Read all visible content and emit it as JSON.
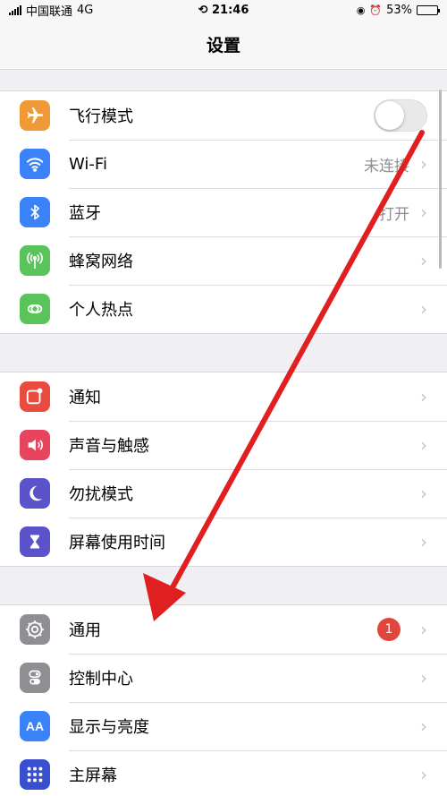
{
  "status_bar": {
    "carrier": "中国联通",
    "network": "4G",
    "time": "21:46",
    "battery": "53%",
    "battery_level": 0.53
  },
  "nav": {
    "title": "设置"
  },
  "groups": [
    {
      "items": [
        {
          "label": "飞行模式",
          "icon": "airplane-icon",
          "color": "#f09a37",
          "control": "toggle",
          "toggle_on": false
        },
        {
          "label": "Wi-Fi",
          "icon": "wifi-icon",
          "color": "#3a82f7",
          "value": "未连接"
        },
        {
          "label": "蓝牙",
          "icon": "bluetooth-icon",
          "color": "#3a82f7",
          "value": "打开"
        },
        {
          "label": "蜂窝网络",
          "icon": "cellular-icon",
          "color": "#5ac35a"
        },
        {
          "label": "个人热点",
          "icon": "hotspot-icon",
          "color": "#5ac35a"
        }
      ]
    },
    {
      "items": [
        {
          "label": "通知",
          "icon": "notifications-icon",
          "color": "#ea4b3f"
        },
        {
          "label": "声音与触感",
          "icon": "sounds-icon",
          "color": "#e6455d"
        },
        {
          "label": "勿扰模式",
          "icon": "moon-icon",
          "color": "#5b53c9"
        },
        {
          "label": "屏幕使用时间",
          "icon": "hourglass-icon",
          "color": "#5b53c9"
        }
      ]
    },
    {
      "items": [
        {
          "label": "通用",
          "icon": "gear-icon",
          "color": "#8e8e93",
          "badge": "1"
        },
        {
          "label": "控制中心",
          "icon": "control-center-icon",
          "color": "#8e8e93"
        },
        {
          "label": "显示与亮度",
          "icon": "display-icon",
          "color": "#3a82f7"
        },
        {
          "label": "主屏幕",
          "icon": "home-screen-icon",
          "color": "#3a4fd0"
        }
      ]
    }
  ],
  "chevron": "›",
  "arrow_color": "#e02020"
}
